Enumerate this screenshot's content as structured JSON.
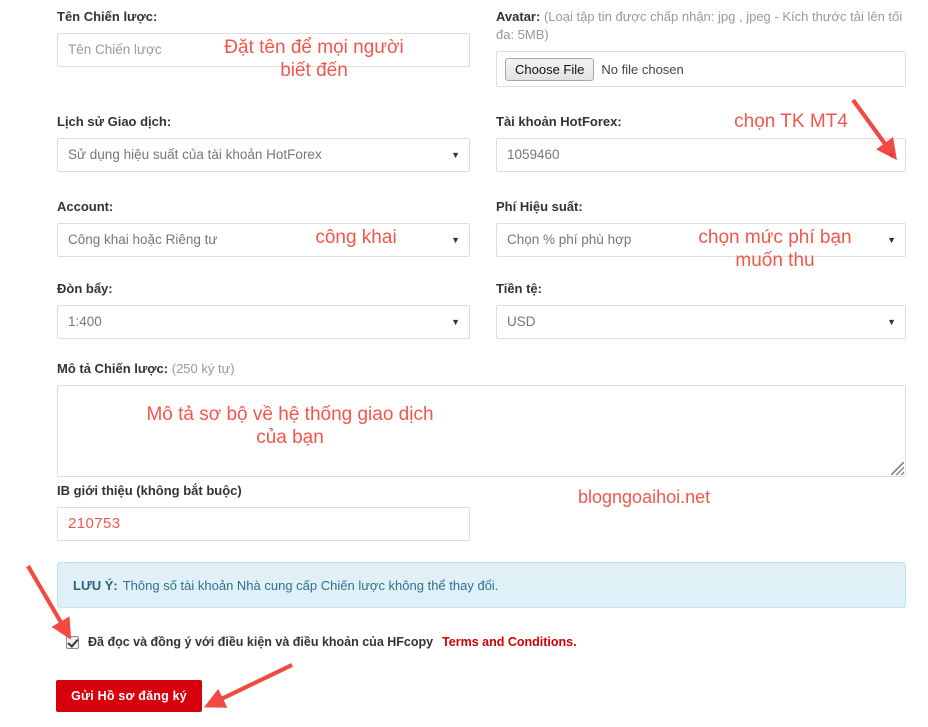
{
  "form": {
    "fields": {
      "strategy_name": {
        "label": "Tên Chiến lược:",
        "placeholder": "Tên Chiến lược"
      },
      "avatar": {
        "label": "Avatar:",
        "hint": "(Loại tập tin được chấp nhận: jpg , jpeg - Kích thước tải lên tối đa: 5MB)",
        "button_label": "Choose File",
        "file_status": "No file chosen"
      },
      "trade_history": {
        "label": "Lịch sử Giao dịch:",
        "value": "Sử dụng hiệu suất của tài khoản HotForex"
      },
      "hotforex_account": {
        "label": "Tài khoản HotForex:",
        "value": "1059460"
      },
      "account_visibility": {
        "label": "Account:",
        "value": "Công khai hoặc Riêng tư"
      },
      "performance_fee": {
        "label": "Phí Hiệu suất:",
        "value": "Chọn % phí phù hợp"
      },
      "leverage": {
        "label": "Đòn bẩy:",
        "value": "1:400"
      },
      "currency": {
        "label": "Tiền tệ:",
        "value": "USD"
      },
      "description": {
        "label": "Mô tả Chiến lược:",
        "hint": "(250 ký tự)",
        "value": ""
      },
      "ib_referral": {
        "label": "IB giới thiệu (không bắt buộc)",
        "value": "210753"
      }
    },
    "notice": {
      "prefix": "LƯU Ý:",
      "text": "Thông số tài khoản Nhà cung cấp Chiến lược không thể thay đổi."
    },
    "agreement": {
      "text": "Đã đọc và đồng ý với điều kiện và điều khoản của HFcopy",
      "link_text": "Terms and Conditions.",
      "checked": true
    },
    "submit_label": "Gửi Hồ sơ đăng ký",
    "caret_glyph": "▼"
  },
  "annotations": [
    {
      "id": "name-note",
      "text": "Đặt tên để mọi người\nbiết đến"
    },
    {
      "id": "mt4-note",
      "text": "chọn TK MT4"
    },
    {
      "id": "public-note",
      "text": "công khai"
    },
    {
      "id": "fee-note",
      "text": "chọn mức phí bạn\nmuốn thu"
    },
    {
      "id": "desc-note",
      "text": "Mô tả sơ bộ về hệ thống giao dịch\ncủa bạn"
    }
  ],
  "watermark": "blogngoaihoi.net",
  "colors": {
    "annotation": "#f4564b",
    "submit_bg": "#d9000d",
    "link": "#d10000",
    "notice_bg": "#dff0f7",
    "notice_text": "#31708f",
    "border": "#dddddd"
  }
}
